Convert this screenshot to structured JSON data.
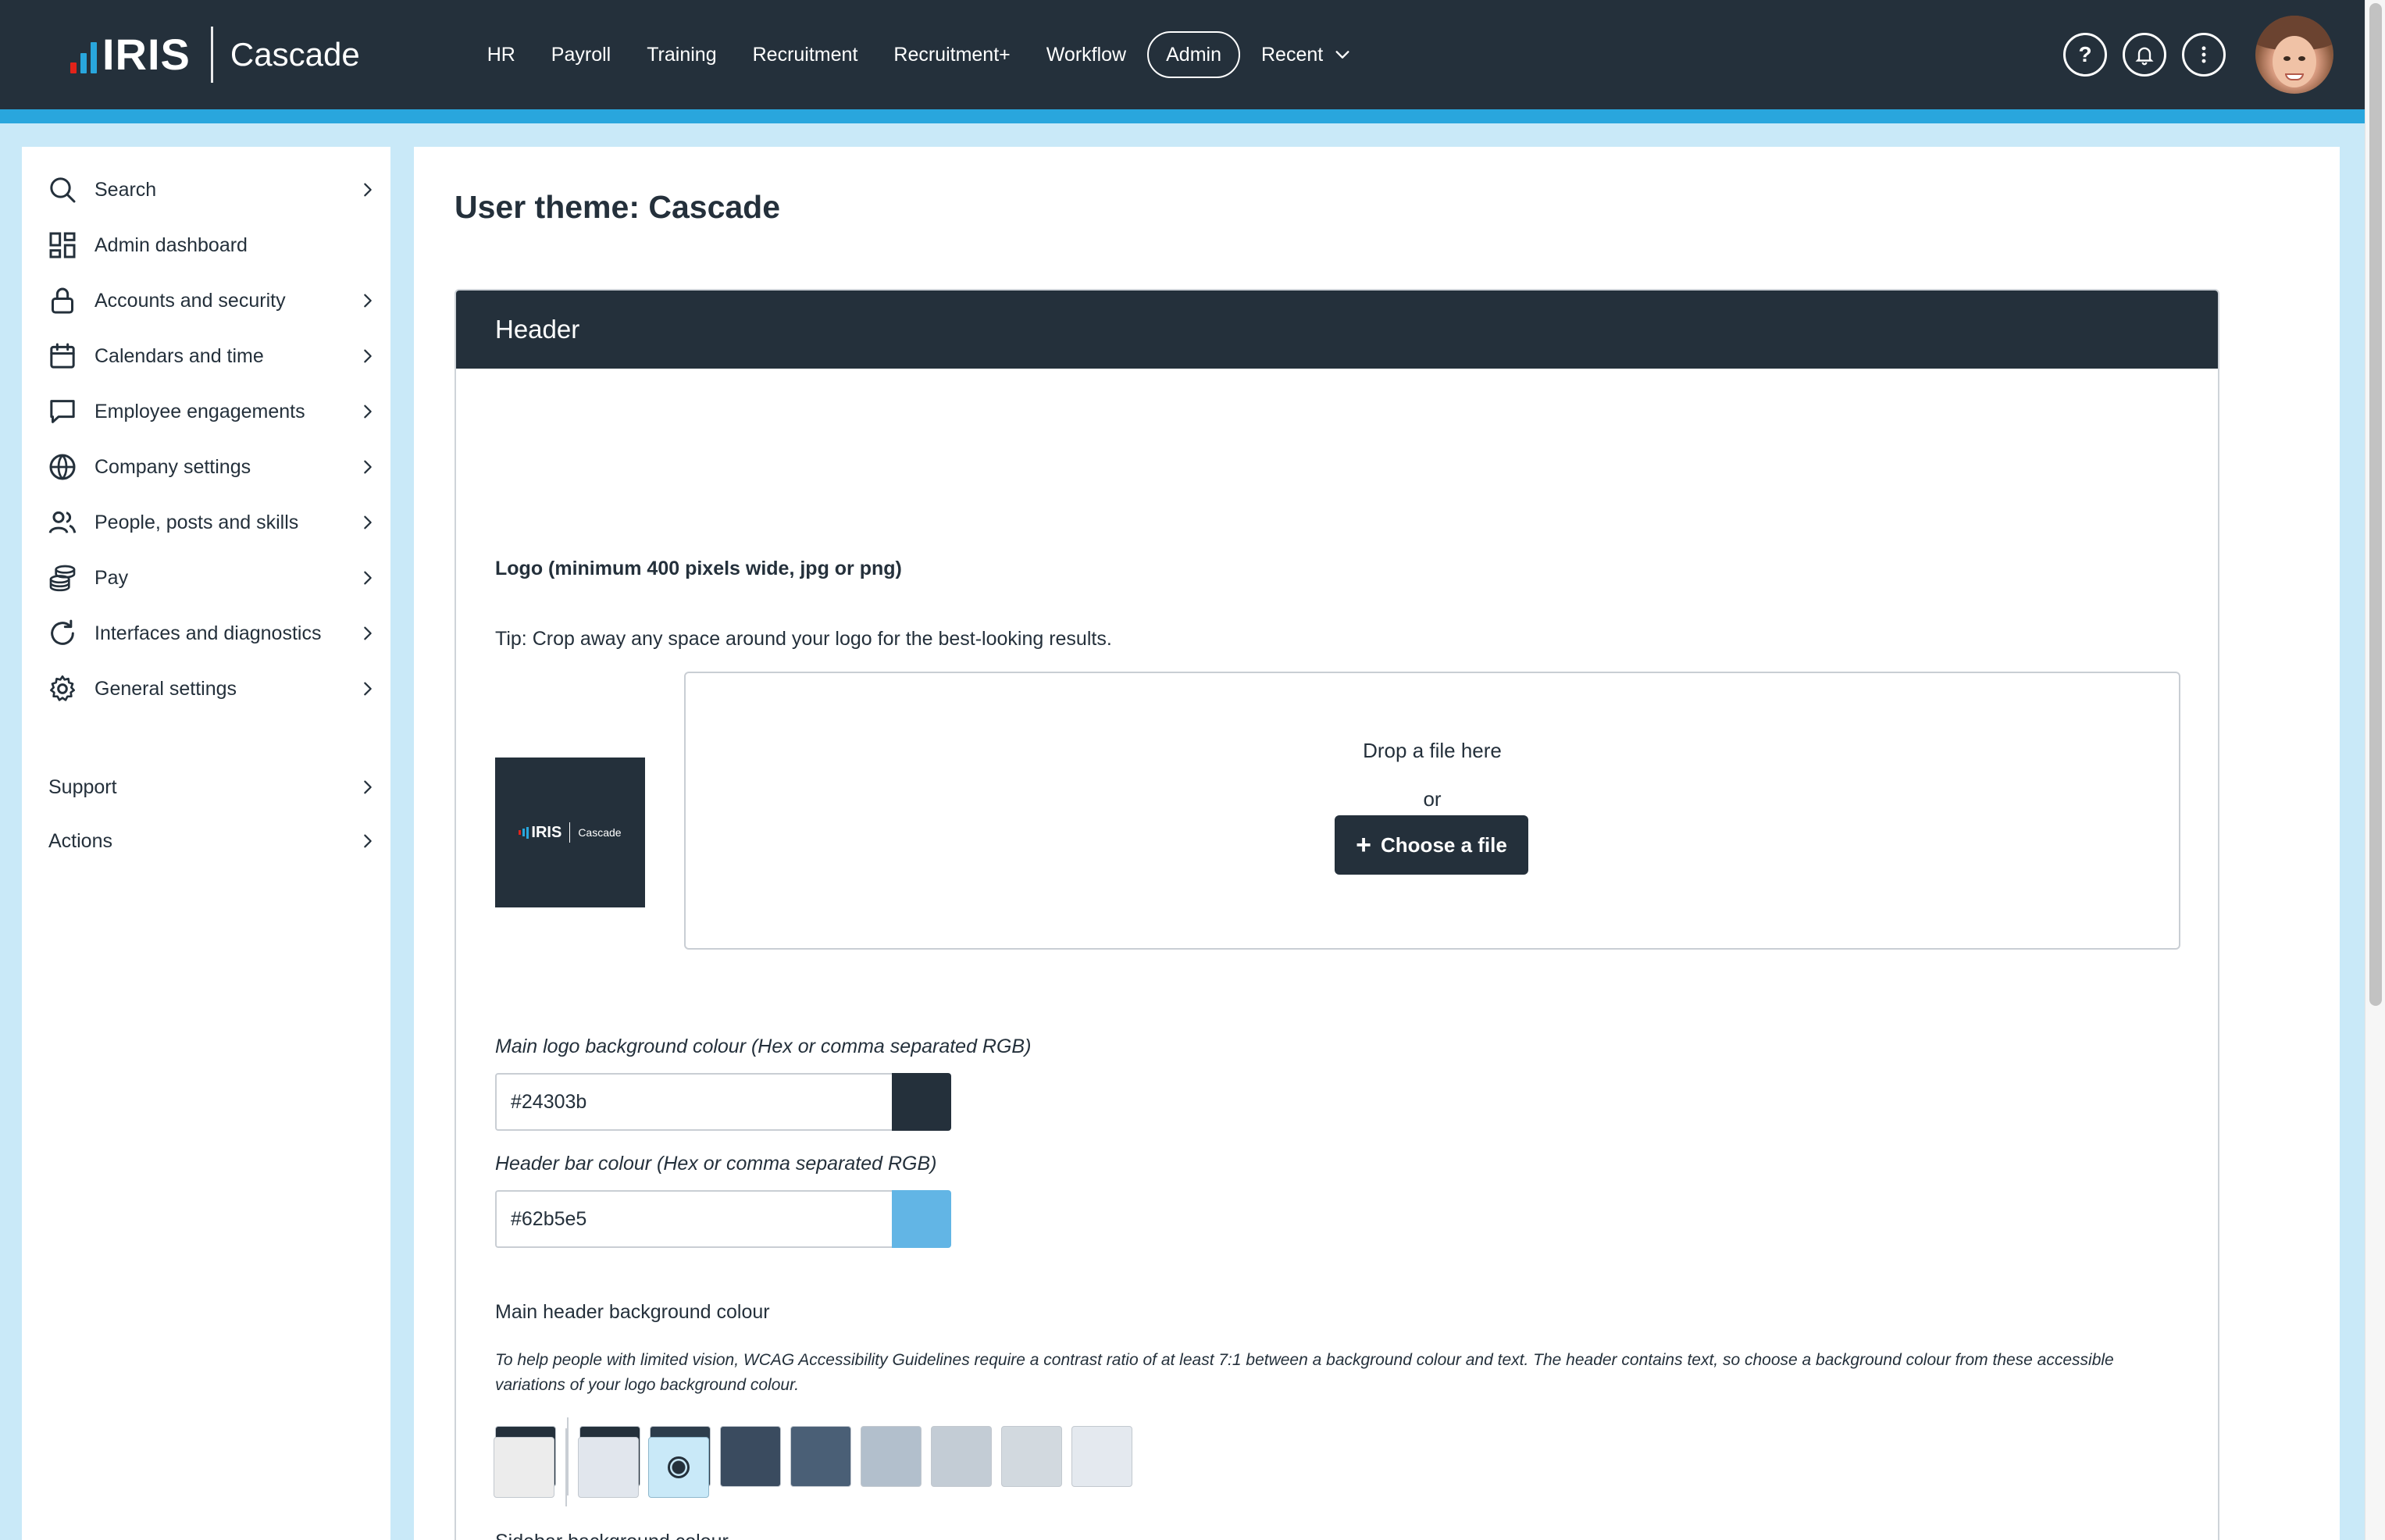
{
  "brand": {
    "logo_text": "IRIS",
    "app_name": "Cascade"
  },
  "topnav": {
    "items": [
      {
        "label": "HR"
      },
      {
        "label": "Payroll"
      },
      {
        "label": "Training"
      },
      {
        "label": "Recruitment"
      },
      {
        "label": "Recruitment+"
      },
      {
        "label": "Workflow"
      },
      {
        "label": "Admin",
        "active": true
      },
      {
        "label": "Recent"
      }
    ],
    "help_glyph": "?",
    "icons": [
      "help-icon",
      "bell-icon",
      "more-vertical-icon",
      "avatar"
    ]
  },
  "sidebar": {
    "items": [
      {
        "label": "Search",
        "icon": "search-icon"
      },
      {
        "label": "Admin dashboard",
        "icon": "dashboard-icon"
      },
      {
        "label": "Accounts and security",
        "icon": "lock-icon"
      },
      {
        "label": "Calendars and time",
        "icon": "calendar-icon"
      },
      {
        "label": "Employee engagements",
        "icon": "chat-icon"
      },
      {
        "label": "Company settings",
        "icon": "globe-icon"
      },
      {
        "label": "People, posts and skills",
        "icon": "people-icon"
      },
      {
        "label": "Pay",
        "icon": "coins-icon"
      },
      {
        "label": "Interfaces and diagnostics",
        "icon": "refresh-icon"
      },
      {
        "label": "General settings",
        "icon": "gear-icon"
      }
    ],
    "footer_items": [
      {
        "label": "Support"
      },
      {
        "label": "Actions"
      }
    ]
  },
  "main": {
    "title": "User theme: Cascade",
    "card": {
      "header": "Header",
      "logo_label": "Logo (minimum 400 pixels wide, jpg or png)",
      "logo_tip": "Tip: Crop away any space around your logo for the best-looking results.",
      "logo_preview": {
        "iris": "IRIS",
        "name": "Cascade"
      },
      "dropzone": {
        "text": "Drop a file here",
        "or": "or",
        "button": "Choose a file",
        "button_glyph": "+"
      },
      "main_logo_bg": {
        "label": "Main logo background colour (Hex or comma separated RGB)",
        "value": "#24303b",
        "color": "#24303b"
      },
      "header_bar": {
        "label": "Header bar colour (Hex or comma separated RGB)",
        "value": "#62b5e5",
        "color": "#62b5e5"
      },
      "main_header_bg": {
        "label": "Main header background colour",
        "note": "To help people with limited vision, WCAG Accessibility Guidelines require a contrast ratio of at least 7:1 between a background colour and text. The header contains text, so choose a background colour from these accessible variations of your logo background colour.",
        "selected": "#24303b",
        "options": [
          "#24303b",
          "#2d3d4c",
          "#3a4b5f",
          "#4a5f76",
          "#b2bfcc",
          "#c3ccd5",
          "#d2d9df",
          "#e4e9ef"
        ]
      },
      "sidebar_bg": {
        "label": "Sidebar background colour",
        "options": [
          "#ececec",
          "#e1e6ed",
          "#c9e9f8"
        ],
        "selected_index": 2
      }
    }
  },
  "colors": {
    "topbar": "#24303b",
    "accent": "#29a6dd",
    "page_bg": "#c9e9f8"
  }
}
